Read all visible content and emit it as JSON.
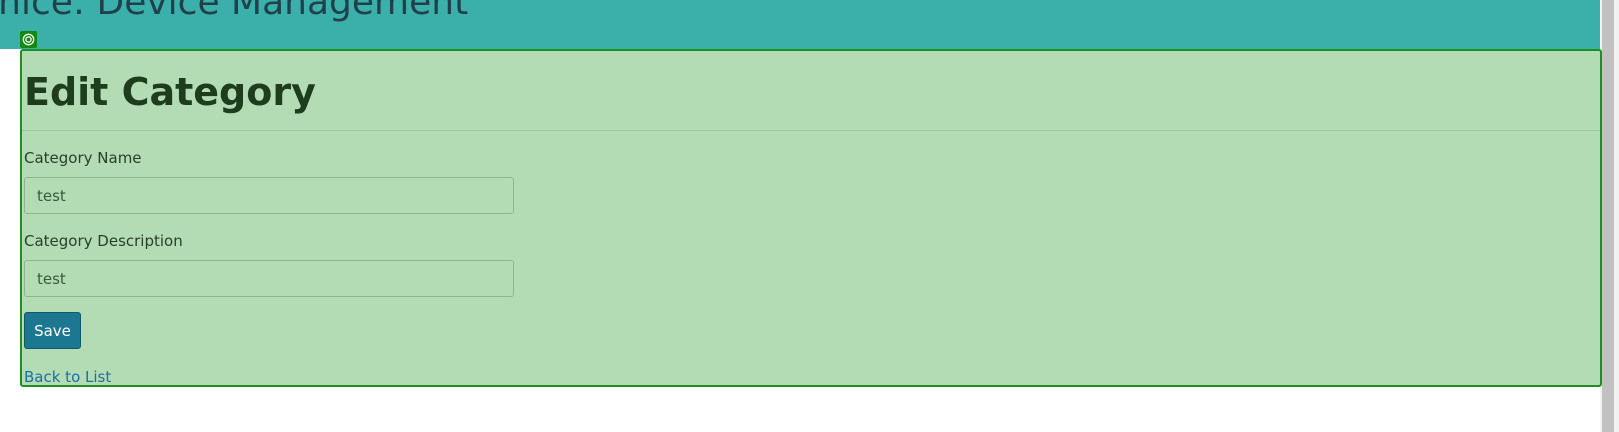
{
  "header": {
    "title": "rnice: Device Management"
  },
  "panel": {
    "title": "Edit Category",
    "handle_icon": "target-icon"
  },
  "form": {
    "name_label": "Category Name",
    "name_value": "test",
    "description_label": "Category Description",
    "description_value": "test",
    "save_label": "Save",
    "back_link_label": "Back to List"
  },
  "colors": {
    "header_bg": "#3bb0ab",
    "panel_bg": "#b4dcb4",
    "panel_border": "#1f8f1f",
    "save_button_bg": "#1c7890",
    "link_color": "#1a6fa8"
  }
}
